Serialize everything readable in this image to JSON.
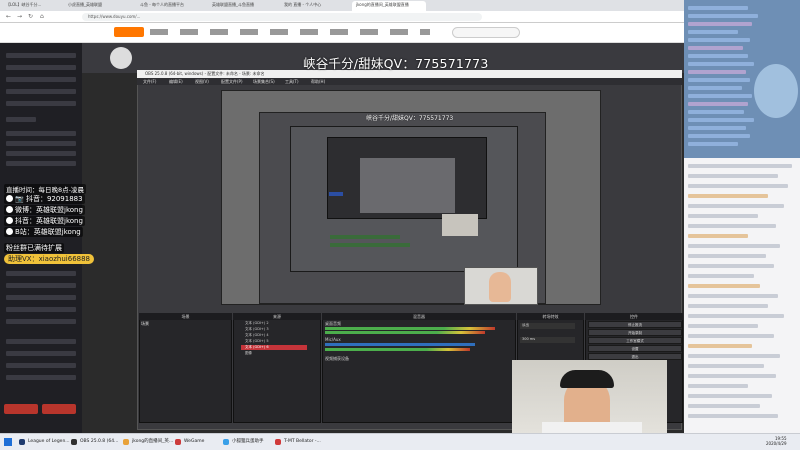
{
  "browser": {
    "tabs": [
      {
        "label": "【LOL】峡谷千分...",
        "active": false
      },
      {
        "label": "小虎直播_英雄联盟",
        "active": false
      },
      {
        "label": "斗鱼 - 每个人的直播平台",
        "active": false
      },
      {
        "label": "英雄联盟直播_斗鱼直播",
        "active": false
      },
      {
        "label": "我的 直播 - 个人中心",
        "active": false
      },
      {
        "label": "jkong的直播间_英雄联盟直播",
        "active": true
      }
    ],
    "url": "https://www.douyu.com/..."
  },
  "overlay": {
    "main_text": "峡谷千分/甜妹QV：775571773",
    "small_text": "峡谷千分/甜妹QV：775571773",
    "left_lines": [
      "直播时间：每日晚8点-凌晨",
      "📷 抖音：92091883",
      "微博：英雄联盟jkong",
      "抖音：英雄联盟jkong",
      "B站：英雄联盟jkong"
    ],
    "section_label": "粉丝群已满待扩展",
    "wechat": "助理VX：xiaozhui66888"
  },
  "obs": {
    "title": "OBS 25.0.8 (64-bit, windows) - 配置文件: 未命名 - 场景: 未命名",
    "menu": [
      "文件(F)",
      "编辑(E)",
      "视图(V)",
      "配置文件(P)",
      "场景集合(S)",
      "工具(T)",
      "帮助(H)"
    ],
    "docks": [
      "场景",
      "来源",
      "混音器",
      "转场特效",
      "控件"
    ],
    "scene": "场景",
    "sources": [
      "文本 (GDI+) 2",
      "文本 (GDI+) 3",
      "文本 (GDI+) 4",
      "文本 (GDI+) 5",
      "文本 (GDI+) 6",
      "图像",
      "视频捕获设备"
    ],
    "mixer": [
      "桌面音频",
      "Mic/Aux",
      "视频捕获设备"
    ],
    "transition": "淡出",
    "transition_duration": "300 ms",
    "controls": [
      "停止推流",
      "开始录制",
      "工作室模式",
      "设置",
      "退出"
    ]
  },
  "taskbar": {
    "items": [
      {
        "label": "League of Legen...",
        "color": "#1e3a6e"
      },
      {
        "label": "OBS 25.0.8 (64...",
        "color": "#303030"
      },
      {
        "label": "jkong的直播间_英...",
        "color": "#e8a23a"
      },
      {
        "label": "WeGame",
        "color": "#cc3b3b"
      },
      {
        "label": "小狐狸兵蛋助手",
        "color": "#3aa0e8"
      },
      {
        "label": "T-MT Bellator -...",
        "color": "#d03a3a"
      }
    ],
    "time": "19:55",
    "date": "2020/4/29"
  }
}
